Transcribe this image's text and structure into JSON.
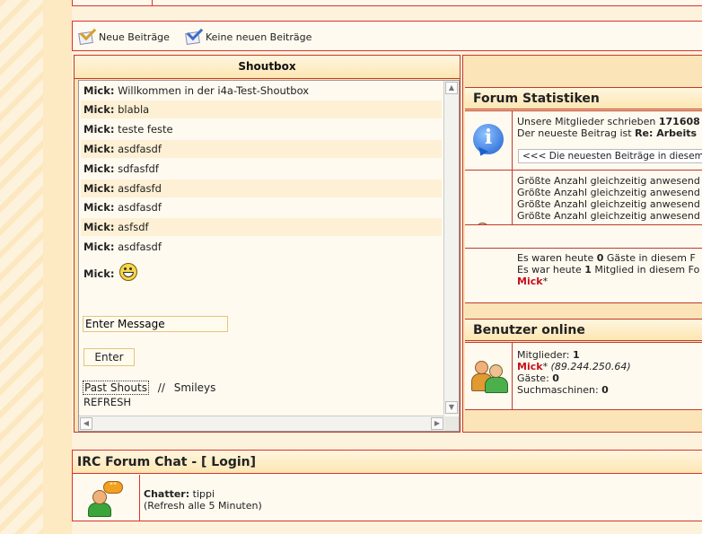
{
  "legend": {
    "new_posts": "Neue Beiträge",
    "no_new_posts": "Keine neuen Beiträge"
  },
  "shoutbox": {
    "title": "Shoutbox",
    "messages": [
      {
        "user": "Mick:",
        "text": "Willkommen in der i4a-Test-Shoutbox"
      },
      {
        "user": "Mick:",
        "text": "blabla"
      },
      {
        "user": "Mick:",
        "text": "teste feste"
      },
      {
        "user": "Mick:",
        "text": "asdfasdf"
      },
      {
        "user": "Mick:",
        "text": "sdfasfdf"
      },
      {
        "user": "Mick:",
        "text": "asdfasfd"
      },
      {
        "user": "Mick:",
        "text": "asdfasdf"
      },
      {
        "user": "Mick:",
        "text": "asfsdf"
      },
      {
        "user": "Mick:",
        "text": "asdfasdf"
      },
      {
        "user": "Mick:",
        "text": ""
      }
    ],
    "input_value": "Enter Message",
    "enter_label": "Enter",
    "past_shouts": "Past Shouts",
    "separator": "//",
    "smileys": "Smileys",
    "refresh": "REFRESH"
  },
  "stats": {
    "title": "Forum Statistiken",
    "posts_line_prefix": "Unsere Mitglieder schrieben ",
    "posts_count": "171608",
    "newest_prefix": "Der neueste Beitrag ist ",
    "newest_title": "Re: Arbeits",
    "newest_button": "<<< Die neuesten Beiträge in diesem",
    "max_lines": [
      "Größte Anzahl gleichzeitig anwesend",
      "Größte Anzahl gleichzeitig anwesend",
      "Größte Anzahl gleichzeitig anwesend",
      "Größte Anzahl gleichzeitig anwesend"
    ],
    "guests_today_prefix": "Es waren heute ",
    "guests_today_count": "0",
    "guests_today_suffix": " Gäste in diesem F",
    "members_today_prefix": "Es war heute ",
    "members_today_count": "1",
    "members_today_suffix": " Mitglied in diesem Fo",
    "member_name": "Mick",
    "member_mark": "*"
  },
  "online": {
    "title": "Benutzer online",
    "members_label": "Mitglieder: ",
    "members_count": "1",
    "user_name": "Mick",
    "user_mark": "*",
    "user_ip": " (89.244.250.64)",
    "guests_label": "Gäste: ",
    "guests_count": "0",
    "bots_label": "Suchmaschinen: ",
    "bots_count": "0"
  },
  "irc": {
    "title": "IRC Forum Chat - [ Login]",
    "chatter_label": "Chatter:",
    "chatter_name": " tippi",
    "refresh_note": "(Refresh alle 5 Minuten)",
    "bubble": "\"\""
  },
  "colors": {
    "accent_red": "#c8101c",
    "border_red": "#d9342b",
    "header_bg": "#fde6b2"
  }
}
